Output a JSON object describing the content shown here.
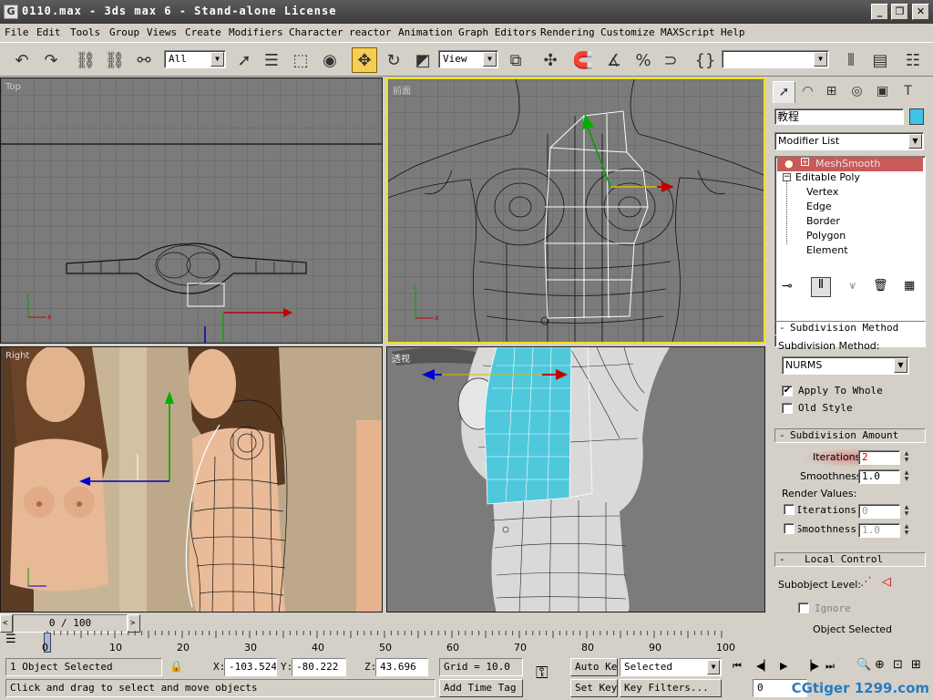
{
  "window": {
    "title": "0110.max - 3ds max 6 - Stand-alone License",
    "app_icon": "G"
  },
  "menu": [
    "File",
    "Edit",
    "Tools",
    "Group",
    "Views",
    "Create",
    "Modifiers",
    "Character",
    "reactor",
    "Animation",
    "Graph Editors",
    "Rendering",
    "Customize",
    "MAXScript",
    "Help"
  ],
  "toolbar": {
    "selection_filter": "All",
    "ref_coord": "View",
    "named_selection": ""
  },
  "viewports": {
    "top_left": {
      "label": "Top"
    },
    "top_right": {
      "label": "前面"
    },
    "bottom_left": {
      "label": "Right"
    },
    "bottom_right": {
      "label": "透视"
    }
  },
  "command_panel": {
    "object_name": "教程",
    "object_color": "#3ec3e6",
    "modifier_list": "Modifier List",
    "stack": {
      "modifier": "MeshSmooth",
      "base": "Editable Poly",
      "subobjects": [
        "Vertex",
        "Edge",
        "Border",
        "Polygon",
        "Element"
      ]
    },
    "subdivision_method": {
      "title": "Subdivision Method",
      "label": "Subdivision Method:",
      "value": "NURMS",
      "apply_to_whole": "Apply To Whole",
      "apply_to_whole_checked": true,
      "old_style": "Old Style",
      "old_style_checked": false
    },
    "subdivision_amount": {
      "title": "Subdivision Amount",
      "iterations_label": "Iterations:",
      "iterations": "2",
      "smoothness_label": "Smoothness:",
      "smoothness": "1.0",
      "render_values": "Render Values:",
      "render_iterations_label": "Iterations:",
      "render_iterations": "0",
      "render_smoothness_label": "Smoothness:",
      "render_smoothness": "1.0"
    },
    "local_control": {
      "title": "Local Control",
      "subobject_level": "Subobject Level:",
      "ignore": "Ignore",
      "object_selected": "Object Selected"
    }
  },
  "time": {
    "frame_display": "0 / 100",
    "ticks": [
      "0",
      "10",
      "20",
      "30",
      "40",
      "50",
      "60",
      "70",
      "80",
      "90",
      "100"
    ]
  },
  "status": {
    "selected": "1 Object Selected",
    "prompt": "Click and drag to select and move objects",
    "x_label": "X:",
    "x": "-103.524",
    "y_label": "Y:",
    "y": "-80.222",
    "z_label": "Z:",
    "z": "43.696",
    "grid": "Grid = 10.0",
    "add_time_tag": "Add Time Tag",
    "auto_key": "Auto Key",
    "set_key": "Set Key",
    "key_mode": "Selected",
    "key_filters": "Key Filters...",
    "current_frame": "0"
  },
  "watermark": "CGtiger 1299.com"
}
